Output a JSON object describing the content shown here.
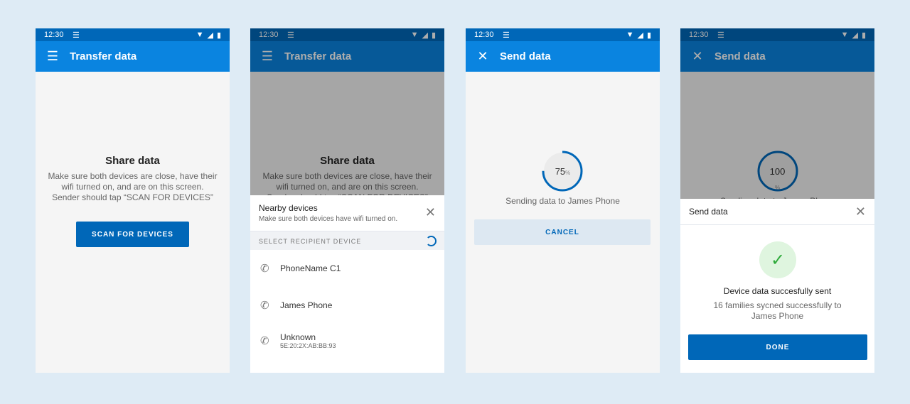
{
  "status": {
    "time": "12:30"
  },
  "screen1": {
    "title": "Transfer data",
    "heading": "Share data",
    "body": [
      "Make sure both devices are close, have their",
      "wifi turned on, and are on this screen.",
      "Sender should tap “SCAN FOR DEVICES”"
    ],
    "button": "SCAN FOR DEVICES"
  },
  "screen2": {
    "title": "Transfer data",
    "heading": "Share data",
    "body": [
      "Make sure both devices are close, have their",
      "wifi turned on, and are on this screen.",
      "Sender should tap “SCAN FOR DEVICES”"
    ],
    "sheet": {
      "title": "Nearby devices",
      "subtitle": "Make sure both devices have wifi turned on.",
      "section": "SELECT RECIPIENT DEVICE",
      "devices": [
        {
          "name": "PhoneName C1",
          "id": ""
        },
        {
          "name": "James Phone",
          "id": ""
        },
        {
          "name": "Unknown",
          "id": "5E:20:2X:AB:BB:93"
        }
      ]
    }
  },
  "screen3": {
    "title": "Send data",
    "progress": 75,
    "progress_label": "75",
    "unit": "%",
    "status": "Sending data to James Phone",
    "button": "CANCEL"
  },
  "screen4": {
    "title": "Send data",
    "progress": 100,
    "progress_label": "100",
    "unit": "%",
    "status": "Sending data to James Phone",
    "sheet": {
      "title": "Send data",
      "heading": "Device data succesfully sent",
      "body": [
        "16 families sycned successfully to",
        "James Phone"
      ],
      "button": "DONE"
    }
  },
  "colors": {
    "primary": "#0067b8",
    "appbar": "#0a84e0",
    "success": "#2eaa3a"
  }
}
